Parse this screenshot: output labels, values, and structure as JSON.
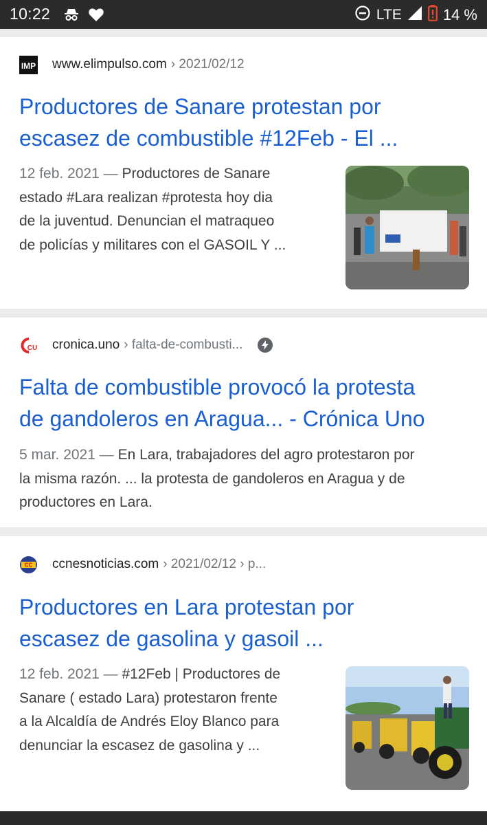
{
  "status_bar": {
    "time": "10:22",
    "network": "LTE",
    "battery": "14 %"
  },
  "results": [
    {
      "favicon_text": "IMP",
      "site": "www.elimpulso.com",
      "path": "› 2021/02/12",
      "title_line1": "Productores de Sanare protestan por",
      "title_line2": "escasez de combustible #12Feb - El ...",
      "date": "12 feb. 2021",
      "dash": " — ",
      "snippet_line1": "Productores de Sanare",
      "snippet_line2": "estado #Lara realizan #protesta hoy dia",
      "snippet_line3": "de la juventud. Denuncian el matraqueo",
      "snippet_line4": "de policías y militares con el GASOIL Y ..."
    },
    {
      "favicon_text": "CU",
      "site": "cronica.uno",
      "path": "› falta-de-combusti...",
      "title_line1": "Falta de combustible provocó la protesta",
      "title_line2": "de gandoleros en Aragua... - Crónica Uno",
      "date": "5 mar. 2021",
      "dash": " — ",
      "snippet_line1": "En Lara, trabajadores del agro protestaron por",
      "snippet_line2": "la misma razón. ... la protesta de gandoleros en Aragua y de",
      "snippet_line3": "productores en Lara."
    },
    {
      "favicon_text": "CC",
      "site": "ccnesnoticias.com",
      "path": "› 2021/02/12 › p...",
      "title_line1": "Productores en Lara protestan por",
      "title_line2": "escasez de gasolina y gasoil ...",
      "date": "12 feb. 2021",
      "dash": " — ",
      "snippet_line1": "#12Feb | Productores de",
      "snippet_line2": "Sanare ( estado Lara) protestaron frente",
      "snippet_line3": "a la Alcaldía de Andrés Eloy Blanco para",
      "snippet_line4": "denunciar la escasez de gasolina y ..."
    }
  ],
  "colors": {
    "link": "#1a5fd0",
    "status_bar": "#2b2b2b",
    "battery_low": "#e8482f"
  }
}
